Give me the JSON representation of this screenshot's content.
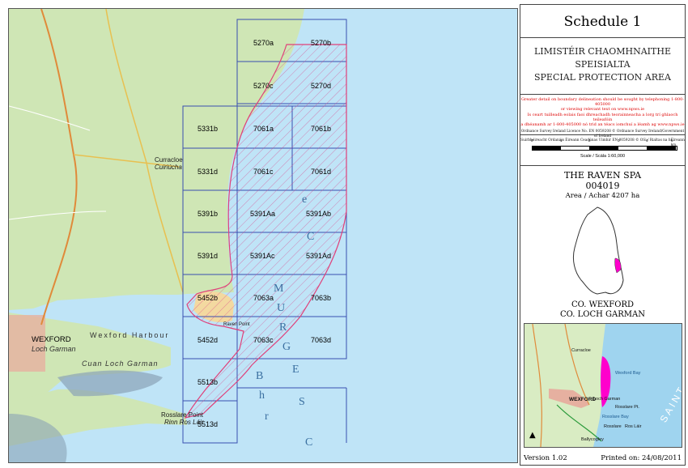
{
  "panel": {
    "title": "Schedule 1",
    "spa_irish_line1": "LIMISTÉIR CHAOMHNAITHE",
    "spa_irish_line2": "SPEISIALTA",
    "spa_english": "SPECIAL PROTECTION AREA",
    "notice_line1": "Greater detail on boundary delineation should be sought by telephoning 1-800-405000",
    "notice_line2": "or viewing relevant text on www.npws.ie",
    "notice_line3": "Is ceart tuilleadh eolais faoi dhreachadh teorainneacha a lorg trí ghlaoch teileafóin",
    "notice_line4": "a dhéanamh ar 1-800-405000 nó trid an téacs iomchuí a léamh ag www.npws.ie",
    "licence_line1": "Ordnance Survey Ireland Licence No. EN 0059208 © Ordnance Survey Ireland/Government of Ireland",
    "licence_line2": "Suirbhéireacht Ordanáis Éireann Ceadúnas Uimhir EN 0059208 © OSi / Rialtas na hÉireann",
    "scale_ticks": [
      "0",
      "1",
      "2",
      "3",
      "4",
      "5 km"
    ],
    "scale_text": "Scale / Scála 1:60,000",
    "site_name": "THE RAVEN SPA",
    "site_code": "004019",
    "area": "Area / Achar 4207 ha",
    "county_en": "CO. WEXFORD",
    "county_ga": "CO. LOCH GARMAN",
    "version": "Version 1.02",
    "printed": "Printed on: 24/08/2011"
  },
  "inset": {
    "labels": [
      "Curracloe",
      "Wexford Bay",
      "WEXFORD",
      "Loch Garman",
      "Rosslare Bay",
      "Rosslare",
      "Ros Láir",
      "Rosslare Pt.",
      "Ballycogley"
    ],
    "saint_text": "SAINT"
  },
  "map": {
    "grid_cells": [
      "5270a",
      "5270b",
      "5270c",
      "5270d",
      "5331b",
      "7061a",
      "7061b",
      "5331d",
      "7061c",
      "7061d",
      "5391b",
      "5391Aa",
      "5391Ab",
      "5391d",
      "5391Ac",
      "5391Ad",
      "5452b",
      "7063a",
      "7063b",
      "5452d",
      "7063c",
      "7063d",
      "5513b",
      "5513d"
    ],
    "place_labels": [
      "WEXFORD",
      "Loch Garman",
      "Wexford Harbour",
      "Cuan Loch Garman",
      "Curracloe",
      "Cuiriúcha",
      "Rosslare Point",
      "Rinn Ros Láir",
      "Raven Point"
    ],
    "sea_letters": [
      "M",
      "U",
      "R",
      "G",
      "E",
      "S",
      "C",
      "B",
      "h",
      "r",
      "e",
      "C"
    ],
    "colors": {
      "land": "#cfe6b5",
      "sea": "#bfe4f7",
      "grid": "#3a4fb0",
      "boundary": "#e0407a",
      "spa_pink": "#ff00cc"
    }
  }
}
